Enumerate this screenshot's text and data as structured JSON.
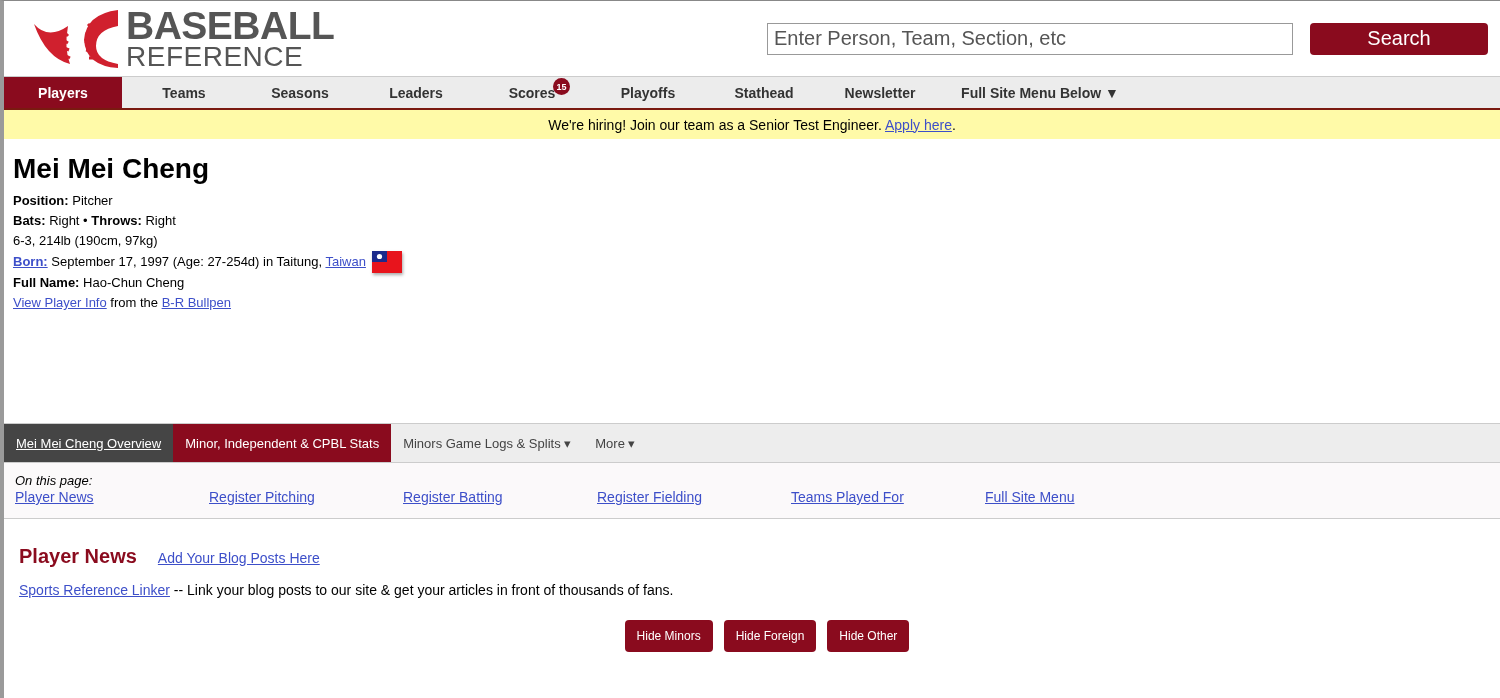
{
  "logo": {
    "line_1": "BASEBALL",
    "line_2": "REFERENCE"
  },
  "search": {
    "placeholder": "Enter Person, Team, Section, etc",
    "button": "Search"
  },
  "nav": [
    {
      "label": "Players",
      "selected": true
    },
    {
      "label": "Teams",
      "selected": false
    },
    {
      "label": "Seasons",
      "selected": false
    },
    {
      "label": "Leaders",
      "selected": false
    },
    {
      "label": "Scores",
      "selected": false,
      "badge": "15"
    },
    {
      "label": "Playoffs",
      "selected": false
    },
    {
      "label": "Stathead",
      "selected": false
    },
    {
      "label": "Newsletter",
      "selected": false
    },
    {
      "label": "Full Site Menu Below ▼",
      "selected": false
    }
  ],
  "banner": {
    "text": "We're hiring! Join our team as a Senior Test Engineer. ",
    "link": "Apply here",
    "after": "."
  },
  "player": {
    "name": "Mei Mei Cheng",
    "lines": [
      "**Position:** Pitcher",
      "**Bats:** Right  •  **Throws:** Right",
      "6-3, 214lb (190cm, 97kg)"
    ],
    "born": {
      "label": "Born:",
      "text": " September 17, 1997 (Age: 27-254d) in Taitung, ",
      "place": "Taiwan"
    },
    "full_name": "**Full Name:** Hao-Chun Cheng",
    "info": {
      "link": "View Player Info",
      "text": " from the ",
      "source": "B-R Bullpen"
    }
  },
  "subnav": [
    {
      "label": "Mei Mei Cheng Overview",
      "kind": "overview",
      "selected": false
    },
    {
      "label": "Minor, Independent & CPBL Stats",
      "kind": "tab",
      "selected": true
    },
    {
      "label": "Minors Game Logs & Splits ▾",
      "kind": "tab",
      "selected": false
    },
    {
      "label": "More ▾",
      "kind": "tab",
      "selected": false
    }
  ],
  "on_this_page": {
    "title": "On this page:",
    "links": [
      "Player News",
      "Register Pitching",
      "Register Batting",
      "Register Fielding",
      "Teams Played For",
      "Full Site Menu"
    ]
  },
  "news": {
    "title": "Player News",
    "add_link": "Add Your Blog Posts Here",
    "linker": "Sports Reference Linker",
    "linker_text": " -- Link your blog posts to our site & get your articles in front of thousands of fans.",
    "buttons": [
      "Hide Minors",
      "Hide Foreign",
      "Hide Other"
    ]
  }
}
